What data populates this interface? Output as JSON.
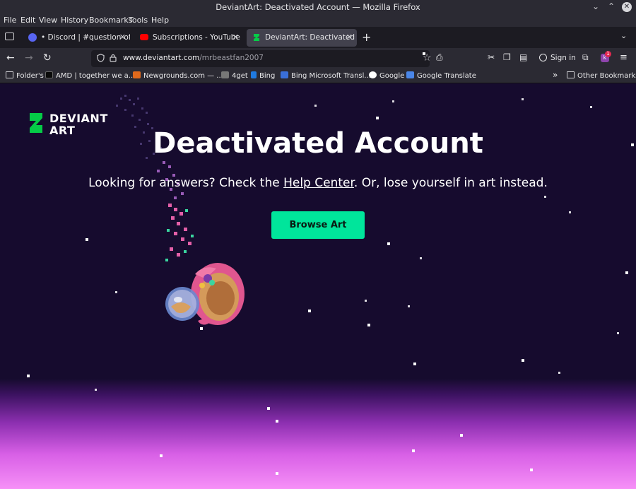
{
  "window": {
    "title": "DeviantArt: Deactivated Account — Mozilla Firefox",
    "minimize_icon": "⌄",
    "maximize_icon": "⌃",
    "close_icon": "✕"
  },
  "menu": {
    "file": "File",
    "edit": "Edit",
    "view": "View",
    "history": "History",
    "bookmarks": "Bookmarks",
    "tools": "Tools",
    "help": "Help"
  },
  "tabs": [
    {
      "label": "• Discord | #question-of-the",
      "favicon_color": "#5865f2",
      "active": false
    },
    {
      "label": "Subscriptions - YouTube",
      "favicon_color": "#ff0000",
      "active": false
    },
    {
      "label": "DeviantArt: Deactivated Acc",
      "favicon_color": "#05cc47",
      "active": true
    }
  ],
  "tab_close_icon": "✕",
  "new_tab_icon": "+",
  "all_tabs_icon": "⌄",
  "nav": {
    "back_icon": "←",
    "forward_icon": "→",
    "reload_icon": "↻",
    "url_domain": "www.deviantart.com",
    "url_path": "/mrbeastfan2007",
    "sign_in": "Sign in",
    "extension_badge_count": "1"
  },
  "bookmarks": [
    {
      "label": "Folder's",
      "type": "folder"
    },
    {
      "label": "AMD | together we a...",
      "color": "#111111"
    },
    {
      "label": "Newgrounds.com — ...",
      "color": "#e0691c"
    },
    {
      "label": "4get",
      "color": "#777777"
    },
    {
      "label": "Bing",
      "color": "#1f7ae0"
    },
    {
      "label": "Bing Microsoft Transl...",
      "color": "#3a6fd8"
    },
    {
      "label": "Google",
      "color": "#ffffff"
    },
    {
      "label": "Google Translate",
      "color": "#4a86e8"
    }
  ],
  "other_bookmarks": "Other Bookmarks",
  "overflow_icon": "»",
  "page": {
    "logo_line1": "DEVIANT",
    "logo_line2": "ART",
    "heading": "Deactivated Account",
    "sub_before": "Looking for answers? Check the ",
    "sub_link": "Help Center",
    "sub_after": ". Or, lose yourself in art instead.",
    "button": "Browse Art"
  },
  "colors": {
    "accent": "#00e59b",
    "page_bg": "#160b2e"
  }
}
